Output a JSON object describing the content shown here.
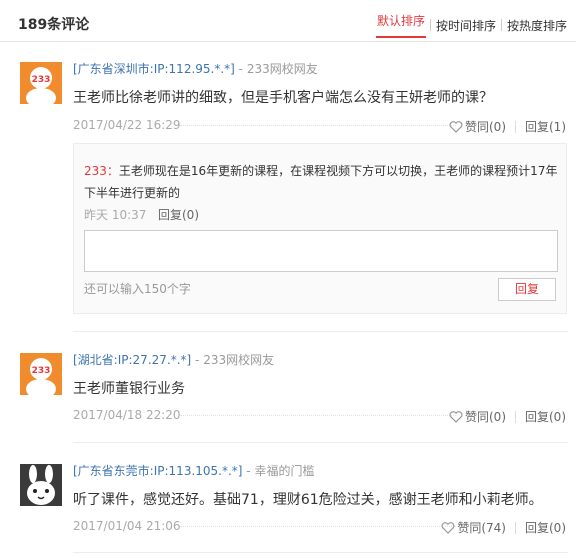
{
  "header": {
    "count": "189条评论",
    "sorts": [
      "默认排序",
      "按时间排序",
      "按热度排序"
    ]
  },
  "comments": [
    {
      "ip": "[广东省深圳市:IP:112.95.*.*]",
      "dash": " - ",
      "user": "233网校网友",
      "avatar": "233-logo-avatar",
      "text": "王老师比徐老师讲的细致，但是手机客户端怎么没有王妍老师的课？",
      "date": "2017/04/22 16:29",
      "like": "赞同(0)",
      "reply": "回复(1)"
    },
    {
      "ip": "[湖北省:IP:27.27.*.*]",
      "dash": " - ",
      "user": "233网校网友",
      "avatar": "233-logo-avatar",
      "text": "王老师董银行业务",
      "date": "2017/04/18 22:20",
      "like": "赞同(0)",
      "reply": "回复(0)"
    },
    {
      "ip": "[广东省东莞市:IP:113.105.*.*]",
      "dash": " - ",
      "user": "幸福的门槛",
      "avatar": "rabbit-avatar",
      "text": "听了课件，感觉还好。基础71，理财61危险过关，感谢王老师和小莉老师。",
      "date": "2017/01/04 21:06",
      "like": "赞同(74)",
      "reply": "回复(0)"
    }
  ],
  "reply": {
    "author": "233：",
    "text": "王老师现在是16年更新的课程，在课程视频下方可以切换，王老师的课程预计17年下半年进行更新的",
    "date": "昨天 10:37",
    "reply_label": "回复(0)",
    "input_value": "",
    "hint": "还可以输入150个字",
    "submit": "回复"
  },
  "colors": {
    "accent": "#e4393c",
    "ip_link": "#3d74b0",
    "avatar_orange": "#f08c2e"
  }
}
